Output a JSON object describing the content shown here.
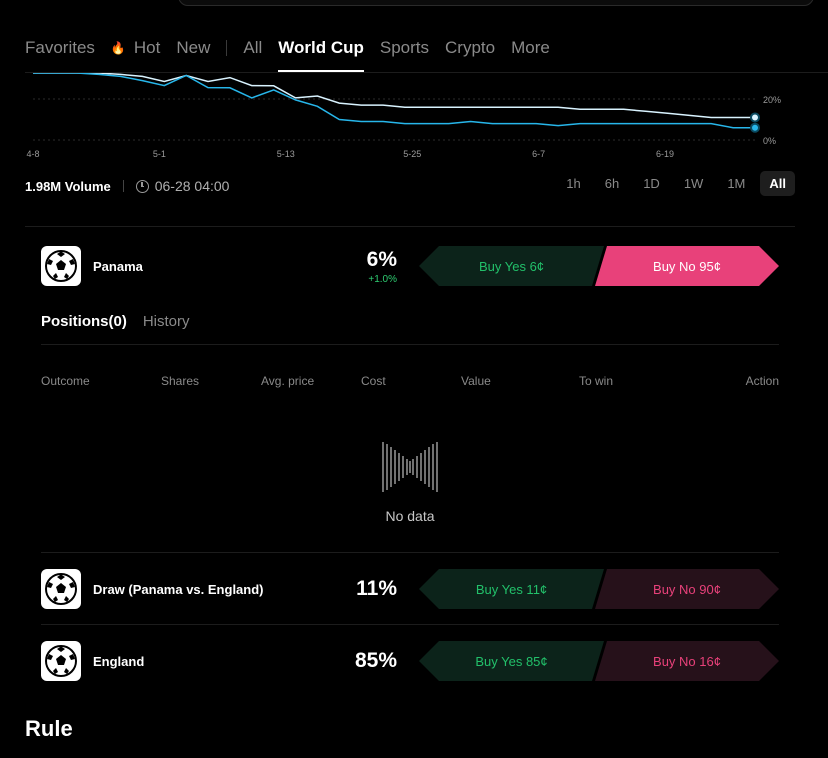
{
  "nav": {
    "items": [
      "Favorites",
      "Hot",
      "New",
      "All",
      "World Cup",
      "Sports",
      "Crypto",
      "More"
    ],
    "active": "World Cup"
  },
  "chart_data": {
    "type": "line",
    "x_ticks": [
      "4-8",
      "5-1",
      "5-13",
      "5-25",
      "6-7",
      "6-19"
    ],
    "y_ticks": [
      "20%",
      "0%"
    ],
    "series": [
      {
        "color": "#d9f3ff",
        "y_percent": [
          38,
          35,
          34,
          33,
          32,
          31,
          30,
          30,
          30,
          29,
          28,
          25,
          22,
          20,
          18,
          17,
          17,
          16,
          16,
          16,
          16,
          16,
          16,
          16,
          16,
          15,
          15,
          15,
          14,
          13,
          12,
          11,
          11,
          11
        ]
      },
      {
        "color": "#27b6ea",
        "y_percent": [
          36,
          34,
          33,
          32,
          31,
          29,
          28,
          30,
          27,
          24,
          22,
          23,
          21,
          15,
          10,
          9,
          9,
          8,
          8,
          8,
          9,
          8,
          8,
          8,
          7,
          8,
          8,
          8,
          8,
          8,
          8,
          8,
          6,
          6
        ]
      }
    ],
    "grid": true
  },
  "stats": {
    "volume": "1.98M Volume",
    "end_date": "06-28 04:00"
  },
  "ranges": [
    "1h",
    "6h",
    "1D",
    "1W",
    "1M",
    "All"
  ],
  "active_range": "All",
  "outcomes": [
    {
      "name": "Panama",
      "pct": "6%",
      "delta": "+1.0%",
      "yes": "Buy Yes 6¢",
      "no": "Buy No 95¢"
    },
    {
      "name": "Draw (Panama vs. England)",
      "pct": "11%",
      "yes": "Buy Yes 11¢",
      "no": "Buy No 90¢"
    },
    {
      "name": "England",
      "pct": "85%",
      "yes": "Buy Yes 85¢",
      "no": "Buy No 16¢"
    }
  ],
  "positions": {
    "tab_positions": "Positions(0)",
    "tab_history": "History",
    "columns": [
      "Outcome",
      "Shares",
      "Avg. price",
      "Cost",
      "Value",
      "To win",
      "Action"
    ],
    "empty_text": "No data"
  },
  "rule_heading": "Rule"
}
